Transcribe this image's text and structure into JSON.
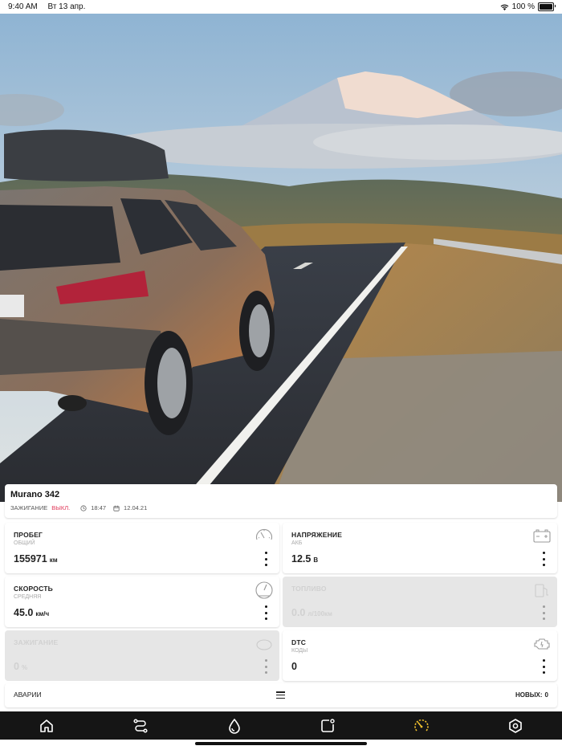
{
  "status_bar": {
    "time": "9:40 AM",
    "date": "Вт 13 апр.",
    "battery": "100 %"
  },
  "vehicle": {
    "name": "Murano 342",
    "ignition_label": "ЗАЖИГАНИЕ",
    "ignition_state": "ВЫКЛ.",
    "time": "18:47",
    "date": "12.04.21"
  },
  "tiles": [
    {
      "title": "ПРОБЕГ",
      "subtitle": "ОБЩИЙ",
      "value": "155971",
      "unit": "км",
      "icon": "odometer-icon",
      "enabled": true
    },
    {
      "title": "НАПРЯЖЕНИЕ",
      "subtitle": "АКБ",
      "value": "12.5",
      "unit": "В",
      "icon": "battery-icon",
      "enabled": true
    },
    {
      "title": "СКОРОСТЬ",
      "subtitle": "СРЕДНЯЯ",
      "value": "45.0",
      "unit": "км/ч",
      "icon": "speedometer-icon",
      "enabled": true
    },
    {
      "title": "ТОПЛИВО",
      "subtitle": "",
      "value": "0.0",
      "unit": "л/100км",
      "icon": "fuel-icon",
      "enabled": false
    },
    {
      "title": "ЗАЖИГАНИЕ",
      "subtitle": "",
      "value": "0",
      "unit": "%",
      "icon": "ignition-icon",
      "enabled": false
    },
    {
      "title": "DTC",
      "subtitle": "КОДЫ",
      "value": "0",
      "unit": "",
      "icon": "engine-check-icon",
      "enabled": true
    }
  ],
  "alarms": {
    "label": "АВАРИИ",
    "new_label": "НОВЫХ:",
    "new_count": "0"
  },
  "tabbar": {
    "items": [
      {
        "icon": "home-icon",
        "active": false
      },
      {
        "icon": "route-icon",
        "active": false
      },
      {
        "icon": "fuel-drop-icon",
        "active": false
      },
      {
        "icon": "notes-icon",
        "active": false
      },
      {
        "icon": "dashboard-icon",
        "active": true
      },
      {
        "icon": "settings-icon",
        "active": false
      }
    ],
    "active_color": "#f2c12e",
    "inactive_color": "#ffffff"
  },
  "colors": {
    "ignition_off": "#e0395a",
    "accent": "#f2c12e"
  }
}
